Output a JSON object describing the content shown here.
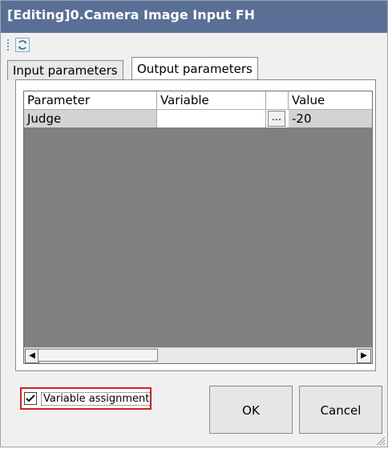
{
  "window": {
    "title": "[Editing]0.Camera Image Input FH"
  },
  "toolbar": {
    "refresh_icon": "refresh-icon"
  },
  "tabs": [
    {
      "label": "Input parameters",
      "active": false
    },
    {
      "label": "Output parameters",
      "active": true
    }
  ],
  "grid": {
    "columns": [
      "Parameter",
      "Variable",
      "",
      "Value"
    ],
    "rows": [
      {
        "parameter": "Judge",
        "variable": "",
        "button_label": "...",
        "value": "-20"
      }
    ]
  },
  "footer": {
    "checkbox_label": "Variable assignment",
    "checkbox_checked": true,
    "ok_label": "OK",
    "cancel_label": "Cancel"
  }
}
